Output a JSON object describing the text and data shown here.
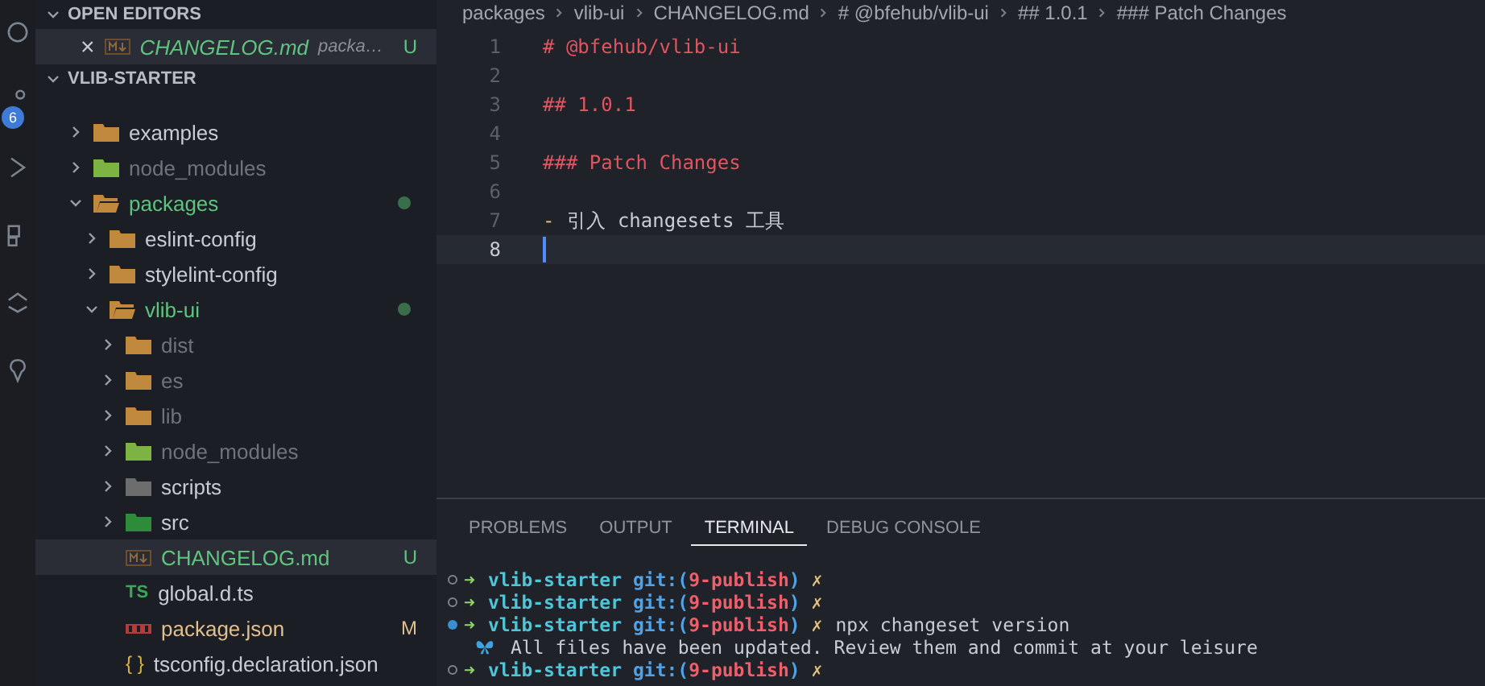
{
  "activity_bar": {
    "badge": "6"
  },
  "open_editors": {
    "title": "OPEN EDITORS",
    "items": [
      {
        "close": "×",
        "name": "CHANGELOG.md",
        "description": "packa…",
        "color": "#5fc47e",
        "letter": "U",
        "selected": true
      }
    ]
  },
  "explorer": {
    "title": "VLIB-STARTER",
    "expanded": true,
    "items": [
      {
        "name": "examples",
        "kind": "folder",
        "color": "#c9ccd3",
        "expanded": false,
        "dot": false
      },
      {
        "name": "node_modules",
        "kind": "folder-node",
        "color": "#6e737c",
        "expanded": false,
        "dot": false
      },
      {
        "name": "packages",
        "kind": "folder",
        "color": "#5fc47e",
        "expanded": true,
        "dot": true,
        "children": [
          {
            "name": "eslint-config",
            "kind": "folder",
            "color": "#c9ccd3",
            "expanded": false,
            "dot": false
          },
          {
            "name": "stylelint-config",
            "kind": "folder",
            "color": "#c9ccd3",
            "expanded": false,
            "dot": false
          },
          {
            "name": "vlib-ui",
            "kind": "folder",
            "color": "#5fc47e",
            "expanded": true,
            "dot": true,
            "children": [
              {
                "name": "dist",
                "kind": "folder-dist",
                "color": "#6e737c",
                "expanded": false,
                "dot": false
              },
              {
                "name": "es",
                "kind": "folder",
                "color": "#6e737c",
                "expanded": false,
                "dot": false
              },
              {
                "name": "lib",
                "kind": "folder-lib",
                "color": "#6e737c",
                "expanded": false,
                "dot": false
              },
              {
                "name": "node_modules",
                "kind": "folder-node",
                "color": "#6e737c",
                "expanded": false,
                "dot": false
              },
              {
                "name": "scripts",
                "kind": "folder-scripts",
                "color": "#c9ccd3",
                "expanded": false,
                "dot": false
              },
              {
                "name": "src",
                "kind": "folder-src",
                "color": "#c9ccd3",
                "expanded": false,
                "dot": false
              },
              {
                "name": "CHANGELOG.md",
                "kind": "markdown",
                "color": "#5fc47e",
                "letter": "U",
                "selected": true
              },
              {
                "name": "global.d.ts",
                "kind": "ts",
                "icon_text": "TS",
                "color": "#c9ccd3",
                "selected": false
              },
              {
                "name": "package.json",
                "kind": "npm",
                "color": "#e2c08d",
                "letter": "M",
                "selected": false
              },
              {
                "name": "tsconfig.declaration.json",
                "kind": "json",
                "icon_text": "{ }",
                "color": "#c9ccd3",
                "selected": false
              }
            ]
          }
        ]
      }
    ]
  },
  "breadcrumb": [
    "packages",
    "vlib-ui",
    "CHANGELOG.md",
    "# @bfehub/vlib-ui",
    "## 1.0.1",
    "### Patch Changes"
  ],
  "editor": {
    "lines": [
      {
        "number": "1",
        "kind": "heading",
        "text": "# @bfehub/vlib-ui",
        "current": false
      },
      {
        "number": "2",
        "kind": "blank",
        "current": false
      },
      {
        "number": "3",
        "kind": "heading",
        "text": "## 1.0.1",
        "current": false
      },
      {
        "number": "4",
        "kind": "blank",
        "current": false
      },
      {
        "number": "5",
        "kind": "heading",
        "text": "### Patch Changes",
        "current": false
      },
      {
        "number": "6",
        "kind": "blank",
        "current": false
      },
      {
        "number": "7",
        "kind": "list",
        "marker": "-",
        "text": "引入 changesets 工具",
        "current": false
      },
      {
        "number": "8",
        "kind": "blank",
        "current": true
      }
    ]
  },
  "panel": {
    "tabs": [
      {
        "label": "PROBLEMS",
        "selected": false
      },
      {
        "label": "OUTPUT",
        "selected": false
      },
      {
        "label": "TERMINAL",
        "selected": true
      },
      {
        "label": "DEBUG CONSOLE",
        "selected": false
      }
    ],
    "terminal": [
      {
        "kind": "prompt",
        "active": false,
        "arrow": "➜",
        "dir": "vlib-starter",
        "git": "git:(",
        "branch": "9-publish",
        "close": ")",
        "dirty": "✗"
      },
      {
        "kind": "prompt",
        "active": false,
        "arrow": "➜",
        "dir": "vlib-starter",
        "git": "git:(",
        "branch": "9-publish",
        "close": ")",
        "dirty": "✗"
      },
      {
        "kind": "prompt",
        "active": true,
        "arrow": "➜",
        "dir": "vlib-starter",
        "git": "git:(",
        "branch": "9-publish",
        "close": ")",
        "dirty": "✗",
        "command": "npx changeset version"
      },
      {
        "kind": "output",
        "text": "All files have been updated. Review them and commit at your leisure"
      },
      {
        "kind": "prompt",
        "active": false,
        "arrow": "➜",
        "dir": "vlib-starter",
        "git": "git:(",
        "branch": "9-publish",
        "close": ")",
        "dirty": "✗"
      }
    ]
  }
}
